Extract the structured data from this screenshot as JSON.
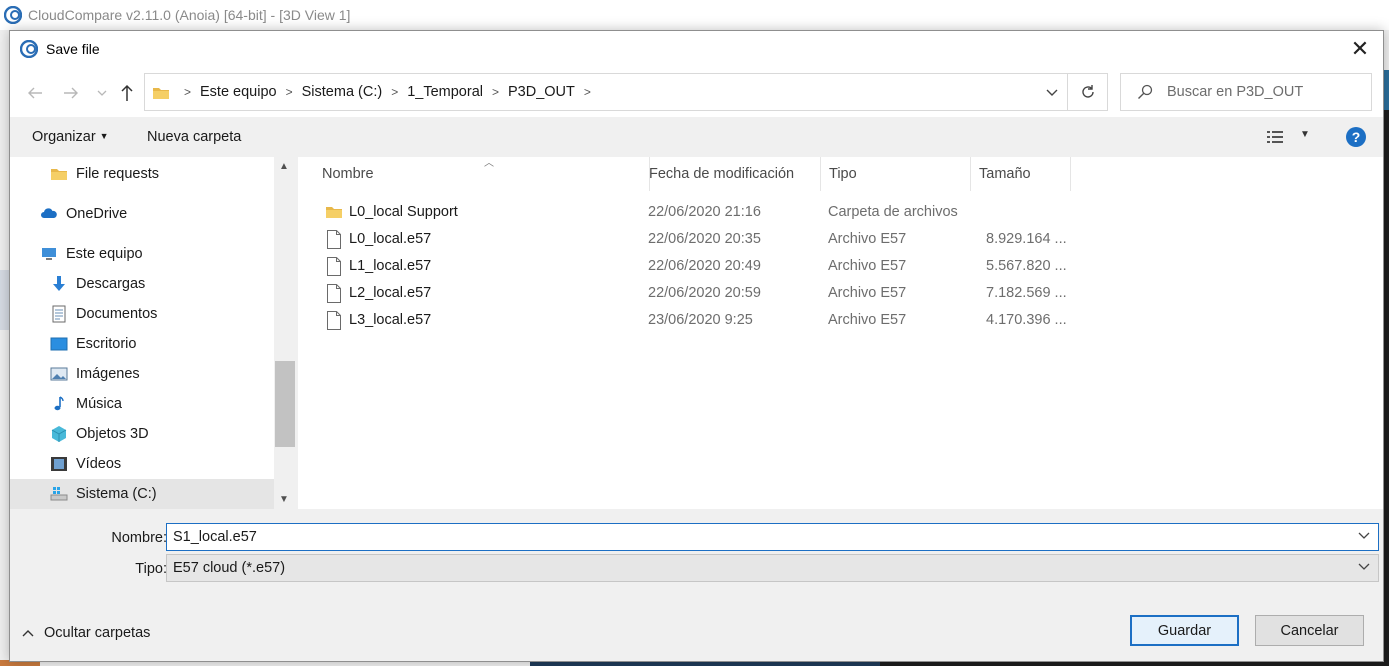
{
  "app": {
    "title": "CloudCompare v2.11.0 (Anoia) [64-bit] - [3D View 1]"
  },
  "dialog": {
    "title": "Save file",
    "close_glyph": "✕"
  },
  "address": {
    "crumbs": [
      "Este equipo",
      "Sistema (C:)",
      "1_Temporal",
      "P3D_OUT"
    ],
    "search_placeholder": "Buscar en P3D_OUT"
  },
  "toolbar": {
    "organize_label": "Organizar",
    "new_folder_label": "Nueva carpeta",
    "help_glyph": "?"
  },
  "sidebar": {
    "items": [
      {
        "label": "File requests",
        "icon": "folder-icon"
      },
      {
        "label": "OneDrive",
        "icon": "cloud-icon"
      },
      {
        "label": "Este equipo",
        "icon": "computer-icon"
      },
      {
        "label": "Descargas",
        "icon": "download-icon"
      },
      {
        "label": "Documentos",
        "icon": "document-icon"
      },
      {
        "label": "Escritorio",
        "icon": "desktop-icon"
      },
      {
        "label": "Imágenes",
        "icon": "image-icon"
      },
      {
        "label": "Música",
        "icon": "music-icon"
      },
      {
        "label": "Objetos 3D",
        "icon": "cube-icon"
      },
      {
        "label": "Vídeos",
        "icon": "video-icon"
      },
      {
        "label": "Sistema (C:)",
        "icon": "drive-icon"
      }
    ],
    "selected": "Sistema (C:)"
  },
  "file_list": {
    "columns": [
      "Nombre",
      "Fecha de modificación",
      "Tipo",
      "Tamaño"
    ],
    "rows": [
      {
        "name": "L0_local Support",
        "date": "22/06/2020 21:16",
        "type": "Carpeta de archivos",
        "size": "",
        "icon": "folder-icon"
      },
      {
        "name": "L0_local.e57",
        "date": "22/06/2020 20:35",
        "type": "Archivo E57",
        "size": "8.929.164 ...",
        "icon": "file-icon"
      },
      {
        "name": "L1_local.e57",
        "date": "22/06/2020 20:49",
        "type": "Archivo E57",
        "size": "5.567.820 ...",
        "icon": "file-icon"
      },
      {
        "name": "L2_local.e57",
        "date": "22/06/2020 20:59",
        "type": "Archivo E57",
        "size": "7.182.569 ...",
        "icon": "file-icon"
      },
      {
        "name": "L3_local.e57",
        "date": "23/06/2020 9:25",
        "type": "Archivo E57",
        "size": "4.170.396 ...",
        "icon": "file-icon"
      }
    ]
  },
  "form": {
    "name_label": "Nombre:",
    "name_value": "S1_local.e57",
    "type_label": "Tipo:",
    "type_value": "E57 cloud (*.e57)",
    "hide_folders_label": "Ocultar carpetas",
    "save_label": "Guardar",
    "cancel_label": "Cancelar"
  },
  "colors": {
    "accent": "#1c6fc4",
    "folder": "#e8b84a",
    "selection": "#e5e5e5"
  }
}
